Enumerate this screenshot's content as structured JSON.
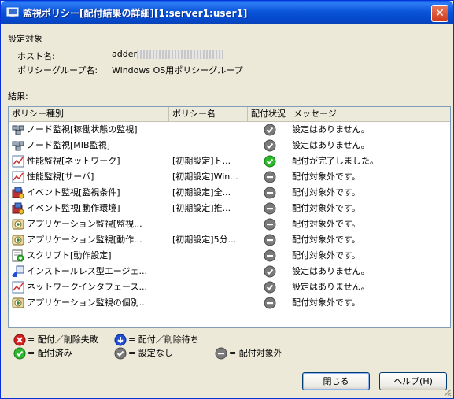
{
  "window": {
    "title": "監視ポリシー[配付結果の詳細][1:server1:user1]",
    "close_glyph": "✕"
  },
  "target": {
    "section_label": "設定対象",
    "host_label": "ホスト名:",
    "host_value": "adder",
    "group_label": "ポリシーグループ名:",
    "group_value": "Windows OS用ポリシーグループ"
  },
  "results_label": "結果:",
  "columns": [
    "ポリシー種別",
    "ポリシー名",
    "配付状況",
    "メッセージ"
  ],
  "rows": [
    {
      "icon": "node-monitor-icon",
      "type": "ノード監視[稼働状態の監視]",
      "name": "",
      "status": "none",
      "message": "設定はありません。"
    },
    {
      "icon": "node-monitor-icon",
      "type": "ノード監視[MIB監視]",
      "name": "",
      "status": "none",
      "message": "設定はありません。"
    },
    {
      "icon": "performance-chart-icon",
      "type": "性能監視[ネットワーク]",
      "name": "[初期設定]ト...",
      "status": "done",
      "message": "配付が完了しました。"
    },
    {
      "icon": "performance-chart-icon",
      "type": "性能監視[サーバ]",
      "name": "[初期設定]Win...",
      "status": "excluded",
      "message": "配付対象外です。"
    },
    {
      "icon": "event-monitor-icon",
      "type": "イベント監視[監視条件]",
      "name": "[初期設定]全...",
      "status": "excluded",
      "message": "配付対象外です。"
    },
    {
      "icon": "event-monitor-icon",
      "type": "イベント監視[動作環境]",
      "name": "[初期設定]推...",
      "status": "excluded",
      "message": "配付対象外です。"
    },
    {
      "icon": "application-monitor-icon",
      "type": "アプリケーション監視[監視...",
      "name": "",
      "status": "excluded",
      "message": "配付対象外です。"
    },
    {
      "icon": "application-monitor-icon",
      "type": "アプリケーション監視[動作...",
      "name": "[初期設定]5分...",
      "status": "excluded",
      "message": "配付対象外です。"
    },
    {
      "icon": "script-icon",
      "type": "スクリプト[動作設定]",
      "name": "",
      "status": "excluded",
      "message": "配付対象外です。"
    },
    {
      "icon": "agentless-install-icon",
      "type": "インストールレス型エージェ...",
      "name": "",
      "status": "none",
      "message": "設定はありません。"
    },
    {
      "icon": "performance-chart-icon",
      "type": "ネットワークインタフェース...",
      "name": "",
      "status": "none",
      "message": "設定はありません。"
    },
    {
      "icon": "application-monitor-icon",
      "type": "アプリケーション監視の個別...",
      "name": "",
      "status": "excluded",
      "message": "配付対象外です。"
    }
  ],
  "legend": {
    "failed": "= 配付／削除失敗",
    "waiting": "= 配付／削除待ち",
    "done": "= 配付済み",
    "none": "= 設定なし",
    "excluded": "= 配付対象外"
  },
  "buttons": {
    "close": "閉じる",
    "help": "ヘルプ(H)"
  },
  "colors": {
    "title_bar": "#0853d8",
    "status_done": "#2eb82e",
    "status_none": "#7a7a7a",
    "status_failed": "#d42020",
    "status_waiting": "#1f4fd8"
  }
}
